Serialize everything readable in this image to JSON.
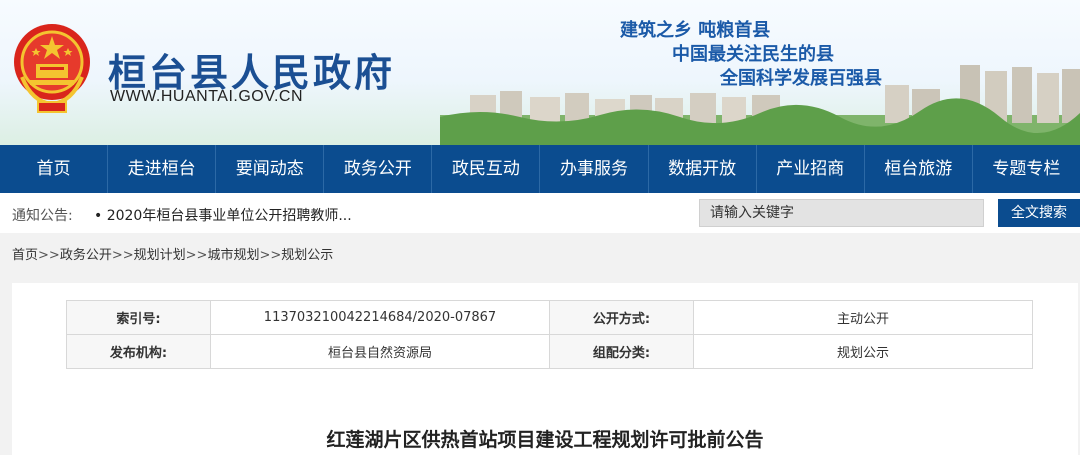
{
  "header": {
    "site_title": "桓台县人民政府",
    "site_url": "WWW.HUANTAI.GOV.CN",
    "slogans": [
      "建筑之乡 吨粮首县",
      "中国最关注民生的县",
      "全国科学发展百强县"
    ]
  },
  "nav": {
    "items": [
      "首页",
      "走进桓台",
      "要闻动态",
      "政务公开",
      "政民互动",
      "办事服务",
      "数据开放",
      "产业招商",
      "桓台旅游",
      "专题专栏"
    ]
  },
  "notice": {
    "label": "通知公告:",
    "text": "• 2020年桓台县事业单位公开招聘教师..."
  },
  "search": {
    "placeholder": "请输入关键字",
    "button": "全文搜索"
  },
  "breadcrumb": [
    "首页",
    "政务公开",
    "规划计划",
    "城市规划",
    "规划公示"
  ],
  "meta": {
    "index_label": "索引号:",
    "index_value": "113703210042214684/2020-07867",
    "open_method_label": "公开方式:",
    "open_method_value": "主动公开",
    "publisher_label": "发布机构:",
    "publisher_value": "桓台县自然资源局",
    "category_label": "组配分类:",
    "category_value": "规划公示"
  },
  "article": {
    "title": "红莲湖片区供热首站项目建设工程规划许可批前公告"
  },
  "colors": {
    "nav_bg": "#0b4c8f",
    "title_blue": "#1b4f93",
    "slogan_blue": "#1b5aa8"
  }
}
